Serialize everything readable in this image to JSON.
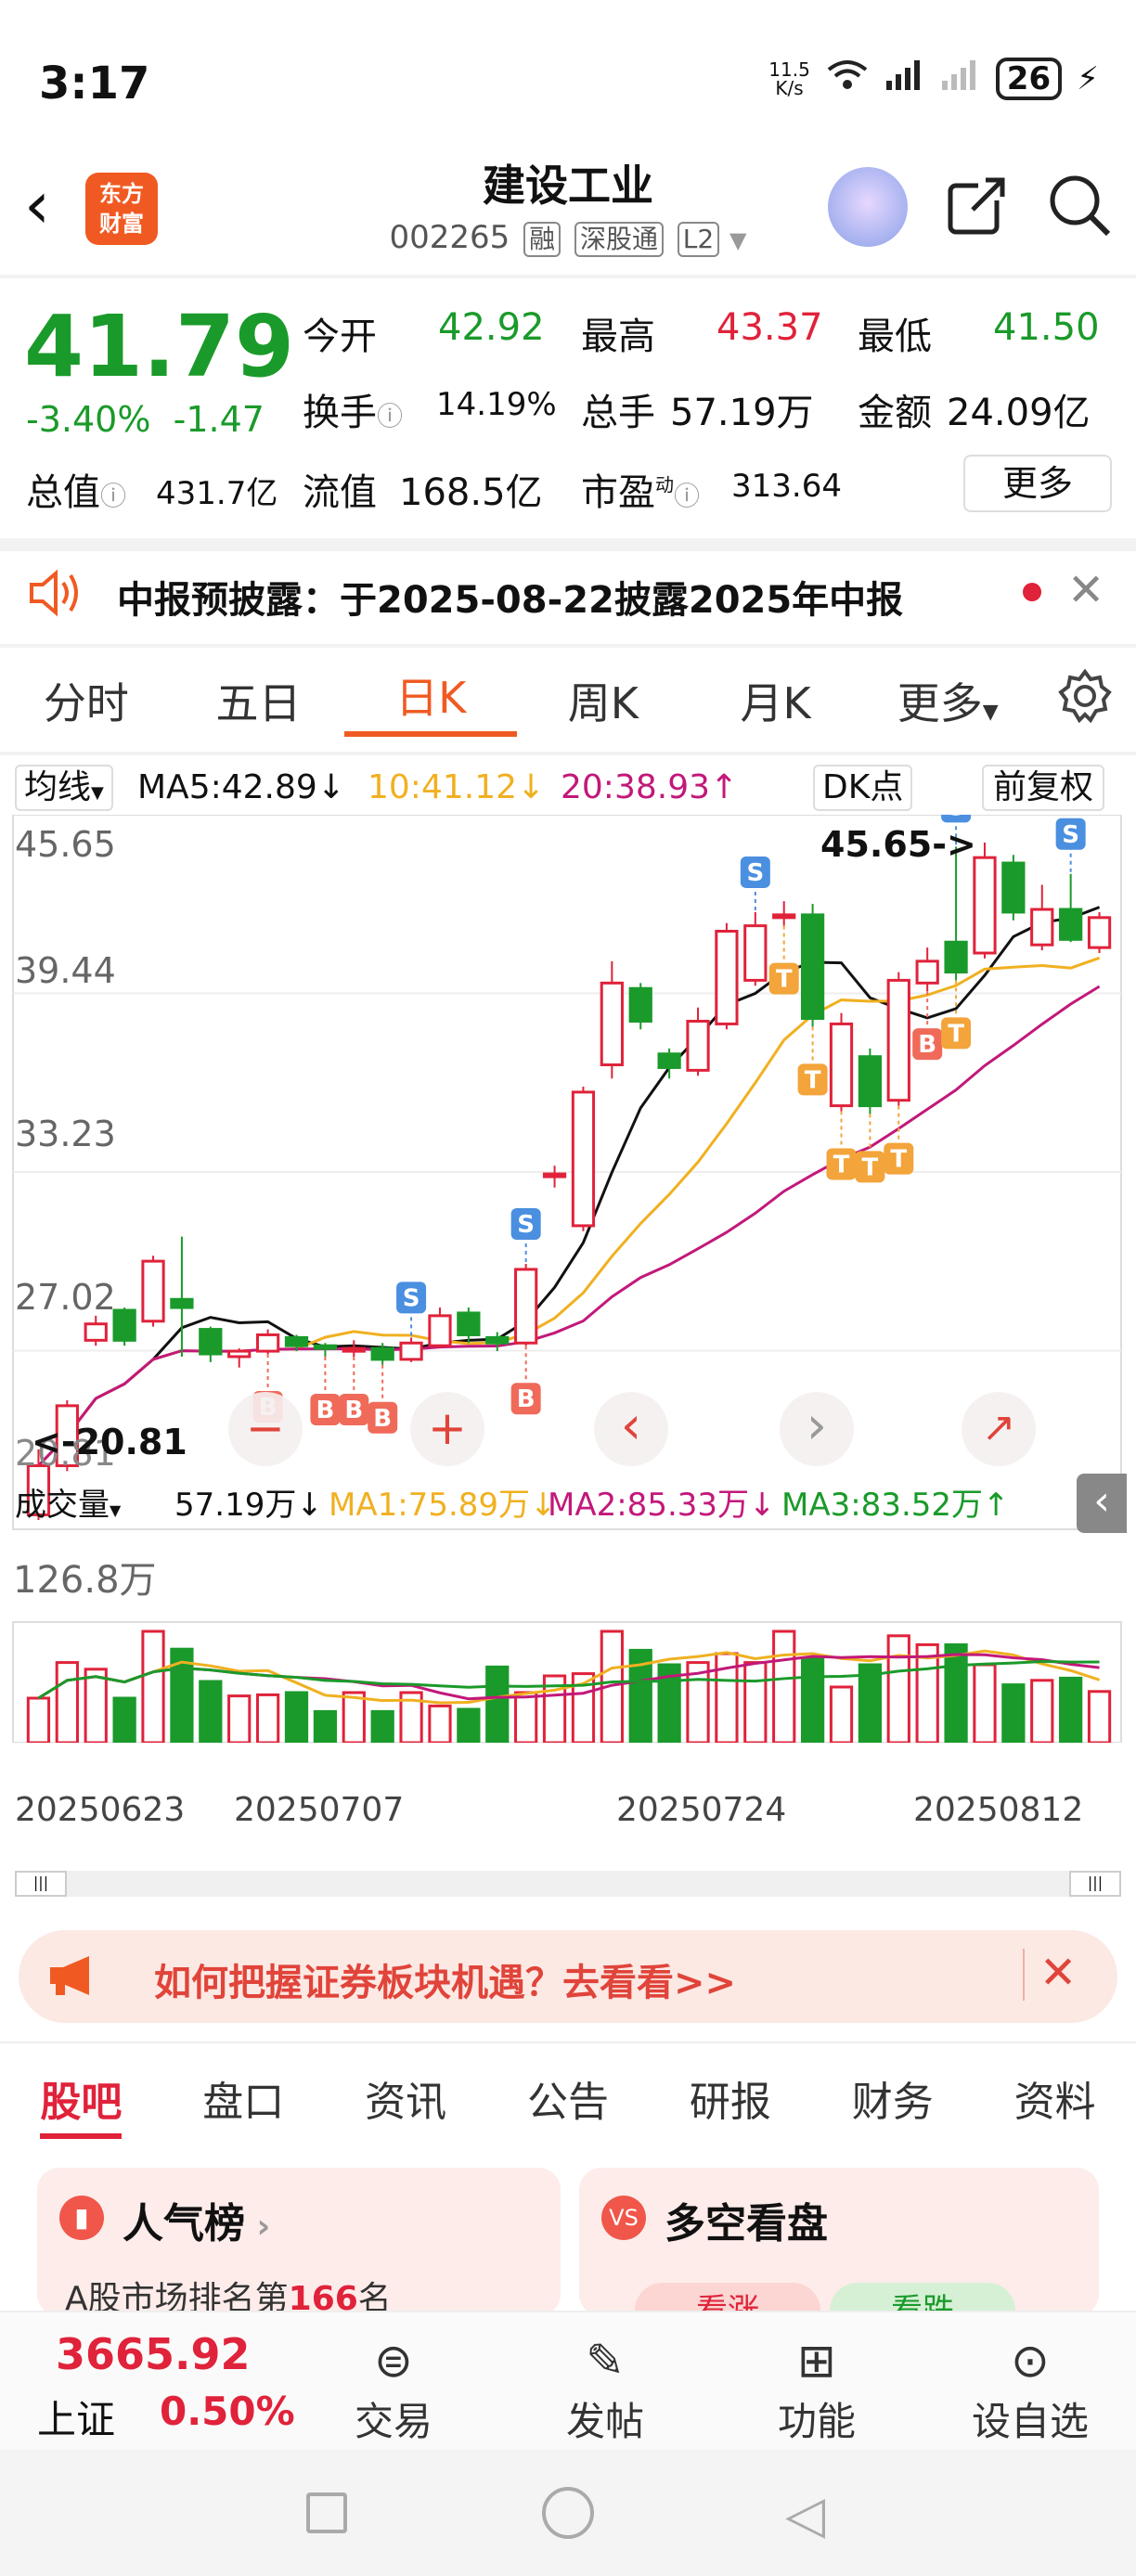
{
  "status_bar": {
    "time": "3:17",
    "net_speed_top": "11.5",
    "net_speed_bottom": "K/s",
    "battery": "26"
  },
  "header": {
    "logo_line1": "东方",
    "logo_line2": "财富",
    "title": "建设工业",
    "code": "002265",
    "tag1": "融",
    "tag2": "深股通",
    "tag3": "L2"
  },
  "quote": {
    "price": "41.79",
    "change_pct": "-3.40%",
    "change_amt": "-1.47",
    "open_label": "今开",
    "open": "42.92",
    "high_label": "最高",
    "high": "43.37",
    "low_label": "最低",
    "low": "41.50",
    "turnover_label": "换手",
    "turnover": "14.19%",
    "volume_label": "总手",
    "volume": "57.19万",
    "amount_label": "金额",
    "amount": "24.09亿",
    "mktcap_label": "总值",
    "mktcap": "431.7亿",
    "float_label": "流值",
    "float": "168.5亿",
    "pe_label": "市盈",
    "pe_sup": "动",
    "pe": "313.64",
    "more": "更多"
  },
  "notice": {
    "text": "中报预披露：于2025-08-22披露2025年中报"
  },
  "ktabs": [
    "分时",
    "五日",
    "日K",
    "周K",
    "月K",
    "更多"
  ],
  "chart_toolbar": {
    "ma_label": "均线",
    "ma5": "MA5:42.89↓",
    "ma10": "10:41.12↓",
    "ma20": "20:38.93↑",
    "dk": "DK点",
    "adjust": "前复权"
  },
  "vol_toolbar": {
    "label": "成交量",
    "vol": "57.19万↓",
    "ma1": "MA1:75.89万↓",
    "ma2": "MA2:85.33万↓",
    "ma3": "MA3:83.52万↑"
  },
  "colors": {
    "up": "#e0223a",
    "down": "#1a9a2a",
    "accent": "#f05a22",
    "ma5": "#111111",
    "ma10": "#f0b020",
    "ma20": "#c2187a"
  },
  "chart_data": {
    "type": "candlestick",
    "y_ticks": [
      "45.65",
      "39.44",
      "33.23",
      "27.02",
      "20.81"
    ],
    "ylim": [
      20.81,
      45.65
    ],
    "high_annot": "45.65->",
    "low_annot": "<-20.81",
    "x_ticks": [
      "20250623",
      "20250707",
      "20250724",
      "20250812"
    ],
    "candles": [
      {
        "o": 21.0,
        "c": 22.8,
        "h": 23.4,
        "l": 20.81
      },
      {
        "o": 22.8,
        "c": 25.0,
        "h": 25.2,
        "l": 22.6
      },
      {
        "o": 27.4,
        "c": 28.0,
        "h": 28.3,
        "l": 27.2
      },
      {
        "o": 28.5,
        "c": 27.4,
        "h": 28.6,
        "l": 27.2
      },
      {
        "o": 28.1,
        "c": 30.3,
        "h": 30.5,
        "l": 27.9
      },
      {
        "o": 28.9,
        "c": 28.6,
        "h": 31.2,
        "l": 26.8
      },
      {
        "o": 27.8,
        "c": 26.9,
        "h": 27.9,
        "l": 26.6
      },
      {
        "o": 26.8,
        "c": 27.0,
        "h": 27.1,
        "l": 26.4
      },
      {
        "o": 27.0,
        "c": 27.6,
        "h": 27.8,
        "l": 26.9
      },
      {
        "o": 27.5,
        "c": 27.2,
        "h": 27.6,
        "l": 27.0
      },
      {
        "o": 27.2,
        "c": 27.1,
        "h": 27.3,
        "l": 26.8
      },
      {
        "o": 27.0,
        "c": 27.1,
        "h": 27.4,
        "l": 26.8
      },
      {
        "o": 27.1,
        "c": 26.7,
        "h": 27.3,
        "l": 26.5
      },
      {
        "o": 26.7,
        "c": 27.3,
        "h": 27.5,
        "l": 26.6
      },
      {
        "o": 27.2,
        "c": 28.3,
        "h": 28.6,
        "l": 27.1
      },
      {
        "o": 28.4,
        "c": 27.6,
        "h": 28.6,
        "l": 27.3
      },
      {
        "o": 27.5,
        "c": 27.3,
        "h": 27.7,
        "l": 27.0
      },
      {
        "o": 27.3,
        "c": 30.0,
        "h": 30.2,
        "l": 27.2
      },
      {
        "o": 33.4,
        "c": 33.5,
        "h": 33.8,
        "l": 33.0
      },
      {
        "o": 31.6,
        "c": 36.5,
        "h": 36.7,
        "l": 31.4
      },
      {
        "o": 37.5,
        "c": 40.5,
        "h": 41.3,
        "l": 37.0
      },
      {
        "o": 40.3,
        "c": 39.1,
        "h": 40.5,
        "l": 38.8
      },
      {
        "o": 37.9,
        "c": 37.4,
        "h": 38.1,
        "l": 37.0
      },
      {
        "o": 37.3,
        "c": 39.1,
        "h": 39.6,
        "l": 37.1
      },
      {
        "o": 39.0,
        "c": 42.4,
        "h": 42.7,
        "l": 38.8
      },
      {
        "o": 40.6,
        "c": 42.6,
        "h": 43.1,
        "l": 40.4
      },
      {
        "o": 43.0,
        "c": 43.0,
        "h": 43.5,
        "l": 42.6
      },
      {
        "o": 43.0,
        "c": 39.2,
        "h": 43.4,
        "l": 38.9
      },
      {
        "o": 36.0,
        "c": 39.0,
        "h": 39.4,
        "l": 35.8
      },
      {
        "o": 37.8,
        "c": 36.0,
        "h": 38.1,
        "l": 35.7
      },
      {
        "o": 36.2,
        "c": 40.6,
        "h": 40.9,
        "l": 36.0
      },
      {
        "o": 40.5,
        "c": 41.3,
        "h": 41.8,
        "l": 40.2
      },
      {
        "o": 42.0,
        "c": 40.9,
        "h": 45.5,
        "l": 40.6
      },
      {
        "o": 41.6,
        "c": 45.1,
        "h": 45.65,
        "l": 41.4
      },
      {
        "o": 44.9,
        "c": 43.1,
        "h": 45.2,
        "l": 42.8
      },
      {
        "o": 41.9,
        "c": 43.2,
        "h": 44.1,
        "l": 41.7
      },
      {
        "o": 43.2,
        "c": 42.1,
        "h": 44.5,
        "l": 42.0
      },
      {
        "o": 41.8,
        "c": 42.9,
        "h": 43.1,
        "l": 41.6
      }
    ],
    "volume": [
      40,
      72,
      66,
      40,
      100,
      84,
      55,
      42,
      43,
      45,
      28,
      45,
      28,
      45,
      33,
      30,
      68,
      45,
      60,
      62,
      100,
      83,
      70,
      72,
      80,
      72,
      100,
      76,
      50,
      70,
      96,
      88,
      88,
      70,
      52,
      56,
      58,
      46
    ],
    "volume_max_label": "126.8万",
    "signals": [
      "S",
      "S",
      "B",
      "B",
      "B",
      "B",
      "S",
      "B",
      "S",
      "T",
      "T",
      "T",
      "T",
      "T",
      "B",
      "T",
      "S"
    ]
  },
  "chart_controls": [
    "−",
    "+",
    "‹",
    "›",
    "↗"
  ],
  "promo": {
    "text": "如何把握证券板块机遇？去看看>>"
  },
  "btabs": [
    "股吧",
    "盘口",
    "资讯",
    "公告",
    "研报",
    "财务",
    "资料"
  ],
  "cards": {
    "left_title": "人气榜",
    "left_sub_pre": "A股市场排名第",
    "left_rank": "166",
    "left_sub_post": "名",
    "right_title": "多空看盘",
    "right_up": "看涨",
    "right_down": "看跌"
  },
  "bottom": {
    "index_value": "3665.92",
    "index_name": "上证",
    "index_pct": "0.50%",
    "trade": "交易",
    "post": "发帖",
    "func": "功能",
    "watch": "设自选"
  }
}
